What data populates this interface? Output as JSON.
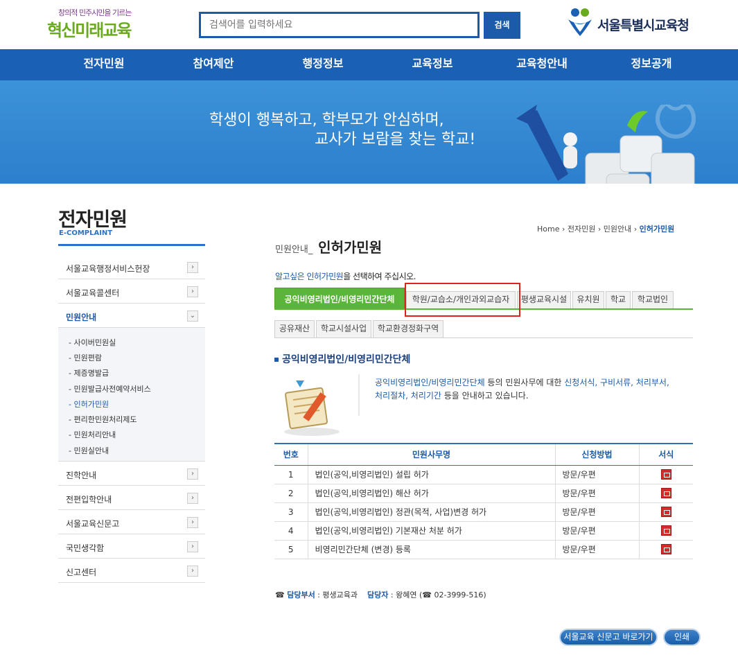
{
  "header": {
    "logo_small": "창의적 민주시민을 기르는",
    "logo_big": "혁신미래교육",
    "search_placeholder": "검색어를 입력하세요",
    "search_button": "검색",
    "brand": "서울특별시교육청"
  },
  "gnb": [
    "전자민원",
    "참여제안",
    "행정정보",
    "교육정보",
    "교육청안내",
    "정보공개"
  ],
  "banner": {
    "line1": "학생이 행복하고, 학부모가 안심하며,",
    "line2": "교사가 보람을 찾는 학교!"
  },
  "sidebar": {
    "title": "전자민원",
    "subtitle": "E-COMPLAINT",
    "items": [
      {
        "label": "서울교육행정서비스헌장"
      },
      {
        "label": "서울교육콜센터"
      },
      {
        "label": "민원안내"
      },
      {
        "label": "진학안내"
      },
      {
        "label": "전편입학안내"
      },
      {
        "label": "서울교육신문고"
      },
      {
        "label": "국민생각함"
      },
      {
        "label": "신고센터"
      }
    ],
    "subitems": [
      "사이버민원실",
      "민원편람",
      "제증명발급",
      "민원발급사전예약서비스",
      "인허가민원",
      "편리한민원처리제도",
      "민원처리안내",
      "민원실안내"
    ]
  },
  "breadcrumb": [
    "Home",
    "전자민원",
    "민원안내",
    "인허가민원"
  ],
  "page": {
    "title_prefix": "민원안내",
    "title": "인허가민원",
    "guide_hl": "알고싶은 인허가민원",
    "guide_rest": "을 선택하여 주십시오."
  },
  "tabs_row1": [
    "공익비영리법인/비영리민간단체",
    "학원/교습소/개인과외교습자",
    "평생교육시설",
    "유치원",
    "학교",
    "학교법인"
  ],
  "tabs_row2": [
    "공유재산",
    "학교시설사업",
    "학교환경정화구역"
  ],
  "section": {
    "title": "공익비영리법인/비영리민간단체",
    "intro_a": "공익비영리법인/비영리민간단체",
    "intro_b": " 등의 민원사무에 대한 ",
    "intro_c": "신청서식, 구비서류, 처리부서, 처리절차, 처리기간",
    "intro_d": " 등을 안내하고 있습니다."
  },
  "table": {
    "headers": [
      "번호",
      "민원사무명",
      "신청방법",
      "서식"
    ],
    "rows": [
      {
        "no": "1",
        "name": "법인(공익,비영리법인) 설립 허가",
        "method": "방문/우편"
      },
      {
        "no": "2",
        "name": "법인(공익,비영리법인) 해산 허가",
        "method": "방문/우편"
      },
      {
        "no": "3",
        "name": "법인(공익,비영리법인) 정관(목적, 사업)변경 허가",
        "method": "방문/우편"
      },
      {
        "no": "4",
        "name": "법인(공익,비영리법인) 기본재산 처분 허가",
        "method": "방문/우편"
      },
      {
        "no": "5",
        "name": "비영리민간단체 (변경) 등록",
        "method": "방문/우편"
      }
    ]
  },
  "contact": {
    "dept_label": "담당부서",
    "dept": "평생교육과",
    "person_label": "담당자",
    "person": "왕혜연",
    "phone": "02-3999-516"
  },
  "footer_buttons": {
    "sinmungo": "서울교육 신문고 바로가기",
    "print": "인쇄"
  },
  "colors": {
    "primary_blue": "#1a60b5",
    "tab_green": "#5bb53a",
    "highlight_red": "#e02020"
  }
}
